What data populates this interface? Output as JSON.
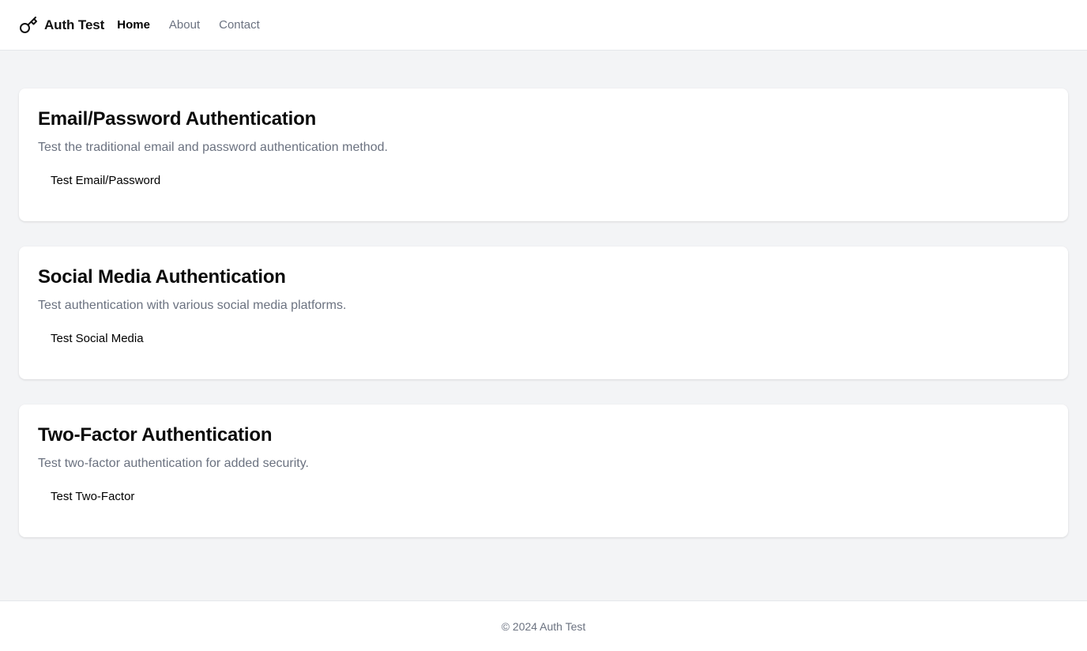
{
  "header": {
    "brand_icon": "key-icon",
    "brand_name": "Auth Test",
    "nav": [
      {
        "label": "Home",
        "active": true
      },
      {
        "label": "About",
        "active": false
      },
      {
        "label": "Contact",
        "active": false
      }
    ]
  },
  "cards": [
    {
      "title": "Email/Password Authentication",
      "description": "Test the traditional email and password authentication method.",
      "button_label": "Test Email/Password"
    },
    {
      "title": "Social Media Authentication",
      "description": "Test authentication with various social media platforms.",
      "button_label": "Test Social Media"
    },
    {
      "title": "Two-Factor Authentication",
      "description": "Test two-factor authentication for added security.",
      "button_label": "Test Two-Factor"
    }
  ],
  "footer": {
    "text": "© 2024 Auth Test"
  },
  "colors": {
    "background": "#f3f4f6",
    "surface": "#ffffff",
    "muted_text": "#6b7280",
    "border": "#e5e7eb"
  }
}
